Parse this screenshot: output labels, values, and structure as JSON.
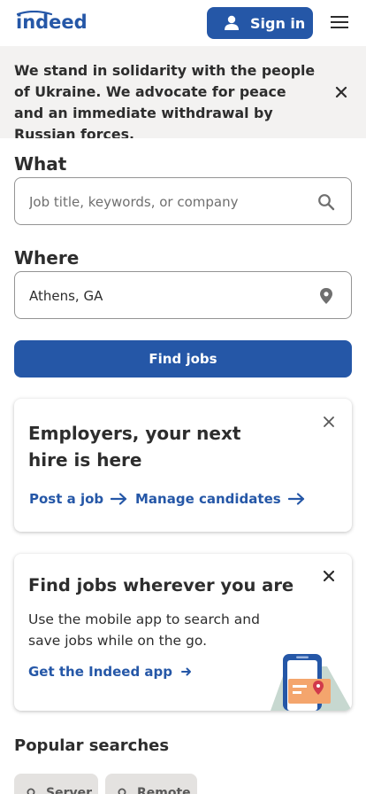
{
  "header": {
    "logo_text": "indeed",
    "signin_label": "Sign in"
  },
  "banner": {
    "text": "We stand in solidarity with the people of Ukraine. We advocate for peace and an immediate withdrawal by Russian forces."
  },
  "search": {
    "what_label": "What",
    "what_placeholder": "Job title, keywords, or company",
    "where_label": "Where",
    "where_value": "Athens, GA",
    "find_button": "Find jobs"
  },
  "employer_card": {
    "title": "Employers, your next hire is here",
    "post_job": "Post a job",
    "manage_candidates": "Manage candidates"
  },
  "app_card": {
    "title": "Find jobs wherever you are",
    "body": "Use the mobile app to search and save jobs while on the go.",
    "link": "Get the Indeed app"
  },
  "popular": {
    "title": "Popular searches",
    "chips": [
      "Server",
      "Remote"
    ]
  },
  "colors": {
    "brand_blue": "#2557a7",
    "chip_bg": "#e4e2e0",
    "banner_bg": "#f3f2f1"
  },
  "icons": [
    "indeed-logo",
    "person-icon",
    "menu-icon",
    "close-icon",
    "search-icon",
    "location-pin-icon",
    "arrow-right-icon",
    "phone-illustration"
  ]
}
